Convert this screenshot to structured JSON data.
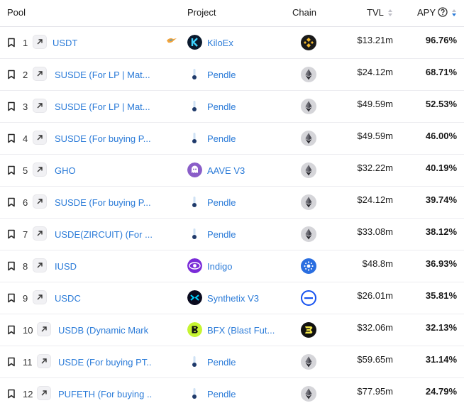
{
  "columns": {
    "pool": "Pool",
    "project": "Project",
    "chain": "Chain",
    "tvl": "TVL",
    "apy": "APY"
  },
  "rows": [
    {
      "rank": "1",
      "pool": "USDT",
      "project": "KiloEx",
      "project_logo": "kiloex",
      "chain": "bsc",
      "tvl": "$13.21m",
      "apy": "96.76%",
      "extra_icon": "bird-icon"
    },
    {
      "rank": "2",
      "pool": "SUSDE (For LP | Mat...",
      "project": "Pendle",
      "project_logo": "pendle",
      "chain": "ethereum",
      "tvl": "$24.12m",
      "apy": "68.71%"
    },
    {
      "rank": "3",
      "pool": "SUSDE (For LP | Mat...",
      "project": "Pendle",
      "project_logo": "pendle",
      "chain": "ethereum",
      "tvl": "$49.59m",
      "apy": "52.53%"
    },
    {
      "rank": "4",
      "pool": "SUSDE (For buying P...",
      "project": "Pendle",
      "project_logo": "pendle",
      "chain": "ethereum",
      "tvl": "$49.59m",
      "apy": "46.00%"
    },
    {
      "rank": "5",
      "pool": "GHO",
      "project": "AAVE V3",
      "project_logo": "aave",
      "chain": "ethereum",
      "tvl": "$32.22m",
      "apy": "40.19%"
    },
    {
      "rank": "6",
      "pool": "SUSDE (For buying P...",
      "project": "Pendle",
      "project_logo": "pendle",
      "chain": "ethereum",
      "tvl": "$24.12m",
      "apy": "39.74%"
    },
    {
      "rank": "7",
      "pool": "USDE(ZIRCUIT) (For ...",
      "project": "Pendle",
      "project_logo": "pendle",
      "chain": "ethereum",
      "tvl": "$33.08m",
      "apy": "38.12%"
    },
    {
      "rank": "8",
      "pool": "IUSD",
      "project": "Indigo",
      "project_logo": "indigo",
      "chain": "cardano",
      "tvl": "$48.8m",
      "apy": "36.93%"
    },
    {
      "rank": "9",
      "pool": "USDC",
      "project": "Synthetix V3",
      "project_logo": "synthetix",
      "chain": "base",
      "tvl": "$26.01m",
      "apy": "35.81%"
    },
    {
      "rank": "10",
      "pool": "USDB (Dynamic Mark",
      "project": "BFX (Blast Fut...",
      "project_logo": "bfx",
      "chain": "blast",
      "tvl": "$32.06m",
      "apy": "32.13%"
    },
    {
      "rank": "11",
      "pool": "USDE (For buying PT...",
      "project": "Pendle",
      "project_logo": "pendle",
      "chain": "ethereum",
      "tvl": "$59.65m",
      "apy": "31.14%"
    },
    {
      "rank": "12",
      "pool": "PUFETH (For buying ...",
      "project": "Pendle",
      "project_logo": "pendle",
      "chain": "ethereum",
      "tvl": "$77.95m",
      "apy": "24.79%"
    }
  ],
  "colors": {
    "link": "#2b7bd8",
    "border": "#e8e8ec"
  }
}
